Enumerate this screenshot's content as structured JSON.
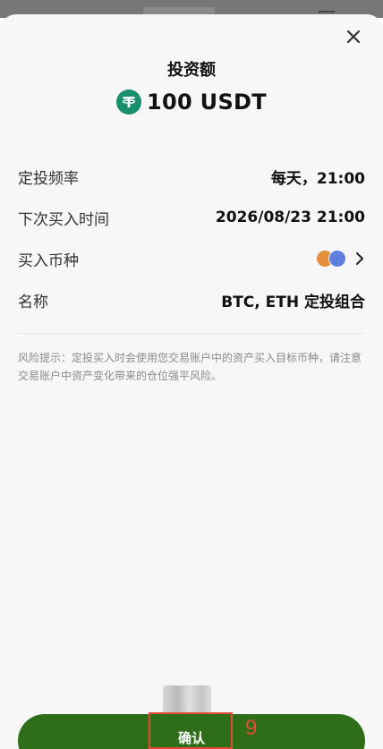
{
  "sheet": {
    "title": "投资额",
    "amount": "100 USDT",
    "icon": "usdt-icon"
  },
  "rows": [
    {
      "label": "定投频率",
      "value": "每天，21:00"
    },
    {
      "label": "下次买入时间",
      "value": "2026/08/23 21:00"
    },
    {
      "label": "买入币种",
      "value": ""
    },
    {
      "label": "名称",
      "value": "BTC, ETH 定投组合"
    }
  ],
  "notice": "风险提示：定投买入时会使用您交易账户中的资产买入目标币种，请注意交易账户中资产变化带来的仓位强平风险。",
  "confirm": {
    "label": "确认"
  },
  "annotation": {
    "step": "9"
  },
  "colors": {
    "accent": "#2e6e18",
    "usdt": "#1a8f6e",
    "btc": "#e4903b",
    "eth": "#5d7fdf",
    "highlight": "#e24a3b"
  }
}
